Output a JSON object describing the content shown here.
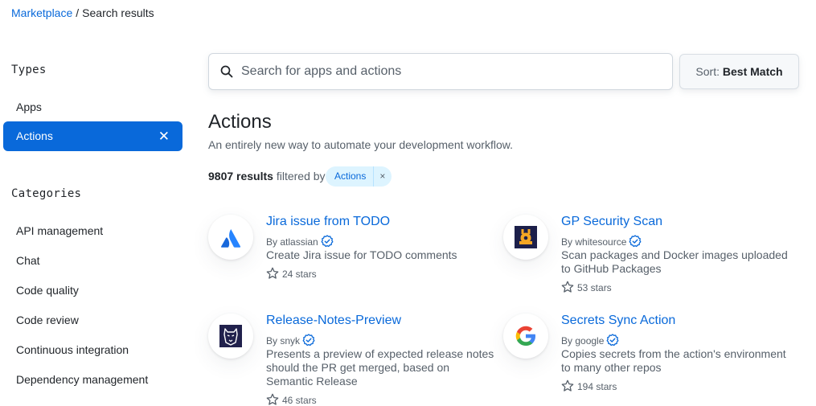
{
  "breadcrumb": {
    "root": "Marketplace",
    "separator": "/",
    "current": "Search results"
  },
  "sidebar": {
    "types_heading": "Types",
    "types": [
      {
        "label": "Apps"
      },
      {
        "label": "Actions",
        "active": true,
        "clear": "✕"
      }
    ],
    "categories_heading": "Categories",
    "categories": [
      {
        "label": "API management"
      },
      {
        "label": "Chat"
      },
      {
        "label": "Code quality"
      },
      {
        "label": "Code review"
      },
      {
        "label": "Continuous integration"
      },
      {
        "label": "Dependency management"
      }
    ]
  },
  "search": {
    "placeholder": "Search for apps and actions",
    "value": "",
    "icon": "search-icon"
  },
  "sort": {
    "prefix": "Sort:",
    "value": "Best Match"
  },
  "page": {
    "title": "Actions",
    "subtitle": "An entirely new way to automate your development workflow."
  },
  "results": {
    "count": "9807 results",
    "filtered_by": "filtered by",
    "filter_label": "Actions",
    "filter_clear": "×"
  },
  "cards": [
    {
      "title": "Jira issue from TODO",
      "by": "By",
      "author": "atlassian",
      "verified": true,
      "description": "Create Jira issue for TODO comments",
      "stars": "24 stars",
      "icon": "atlassian-logo-icon",
      "color": "#2684ff"
    },
    {
      "title": "GP Security Scan",
      "by": "By",
      "author": "whitesource",
      "verified": true,
      "description": "Scan packages and Docker images uploaded to GitHub Packages",
      "stars": "53 stars",
      "icon": "whitesource-logo-icon",
      "color": "#1c1f4a"
    },
    {
      "title": "Release-Notes-Preview",
      "by": "By",
      "author": "snyk",
      "verified": true,
      "description": "Presents a preview of expected release notes should the PR get merged, based on Semantic Release",
      "stars": "46 stars",
      "icon": "snyk-logo-icon",
      "color": "#21214c"
    },
    {
      "title": "Secrets Sync Action",
      "by": "By",
      "author": "google",
      "verified": true,
      "description": "Copies secrets from the action's environment to many other repos",
      "stars": "194 stars",
      "icon": "google-logo-icon",
      "color": "#4285f4"
    }
  ],
  "colors": {
    "accent": "#0969da",
    "verified": "#0969da",
    "pill_bg": "#ddf4ff"
  }
}
